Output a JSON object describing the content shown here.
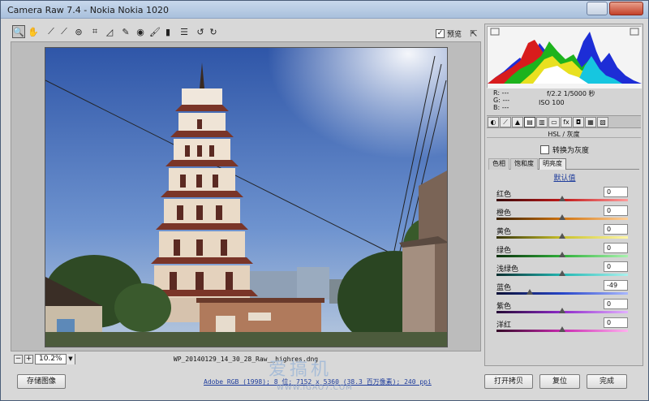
{
  "window": {
    "title": "Camera Raw 7.4 -  Nokia Nokia 1020"
  },
  "toolbar": {
    "preview_label": "预览",
    "preview_checked": true,
    "tools": [
      "zoom-tool-icon",
      "hand-tool-icon",
      "white-balance-tool-icon",
      "color-sampler-tool-icon",
      "target-adjust-tool-icon",
      "crop-tool-icon",
      "straighten-tool-icon",
      "spot-removal-tool-icon",
      "red-eye-tool-icon",
      "adjustment-brush-icon",
      "graduated-filter-icon",
      "preferences-icon",
      "rotate-ccw-icon",
      "rotate-cw-icon"
    ]
  },
  "canvas": {
    "zoom": "10.2%",
    "filename": "WP_20140129_14_30_28_Raw__highres.dng"
  },
  "histogram": {
    "r": "R: ---",
    "g": "G: ---",
    "b": "B: ---",
    "aperture_shutter": "f/2.2  1/5000 秒",
    "iso": "ISO 100"
  },
  "panel": {
    "section_title": "HSL / 灰度",
    "convert_gray_label": "转换为灰度",
    "subtabs": [
      "色相",
      "饱和度",
      "明亮度"
    ],
    "active_subtab": 2,
    "default_link": "默认值",
    "sliders": [
      {
        "label": "红色",
        "value": "0",
        "level": 0,
        "gradient": "linear-gradient(90deg,#3a0b0b,#c01818,#ff9a9a)"
      },
      {
        "label": "橙色",
        "value": "0",
        "level": 0,
        "gradient": "linear-gradient(90deg,#3a2100,#d0730f,#ffd09a)"
      },
      {
        "label": "黄色",
        "value": "0",
        "level": 0,
        "gradient": "linear-gradient(90deg,#35330a,#c9c12a,#fff7a8)"
      },
      {
        "label": "绿色",
        "value": "0",
        "level": 0,
        "gradient": "linear-gradient(90deg,#0b300d,#2fb03a,#a8f2ae)"
      },
      {
        "label": "浅绿色",
        "value": "0",
        "level": 0,
        "gradient": "linear-gradient(90deg,#0a2f30,#22b7b2,#aaf2ee)"
      },
      {
        "label": "蓝色",
        "value": "-49",
        "level": -49,
        "gradient": "linear-gradient(90deg,#0a0f35,#2645c8,#a9b8ff)"
      },
      {
        "label": "紫色",
        "value": "0",
        "level": 0,
        "gradient": "linear-gradient(90deg,#250a35,#8e2ac9,#e2b0ff)"
      },
      {
        "label": "洋红",
        "value": "0",
        "level": 0,
        "gradient": "linear-gradient(90deg,#350a28,#c92ab0,#ffb0ee)"
      }
    ]
  },
  "footer": {
    "save_label": "存储图像",
    "workflow_link": "Adobe RGB (1998); 8 位; 7152 x 5360 (38.3 百万像素); 240 ppi",
    "open_copy_label": "打开拷贝",
    "reset_label": "复位",
    "done_label": "完成"
  },
  "watermark": {
    "main": "爱搞机",
    "sub": "WWW.iGAO7.COM"
  }
}
